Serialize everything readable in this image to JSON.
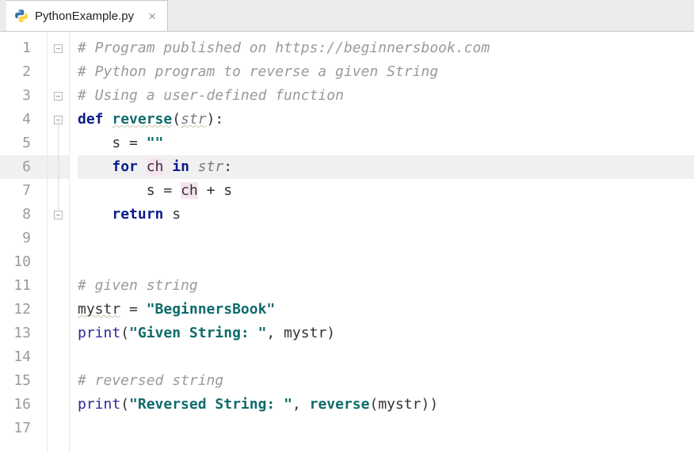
{
  "tab": {
    "filename": "PythonExample.py",
    "icon": "python-file-icon"
  },
  "editor": {
    "highlighted_line": 6,
    "line_numbers": [
      "1",
      "2",
      "3",
      "4",
      "5",
      "6",
      "7",
      "8",
      "9",
      "10",
      "11",
      "12",
      "13",
      "14",
      "15",
      "16",
      "17"
    ],
    "code_lines": [
      {
        "n": 1,
        "tokens": [
          {
            "t": "# Program published on https://beginnersbook.com",
            "c": "c-comment"
          }
        ]
      },
      {
        "n": 2,
        "tokens": [
          {
            "t": "# Python program to reverse a given String",
            "c": "c-comment"
          }
        ]
      },
      {
        "n": 3,
        "tokens": [
          {
            "t": "# Using a user-defined function",
            "c": "c-comment"
          }
        ]
      },
      {
        "n": 4,
        "tokens": [
          {
            "t": "def ",
            "c": "c-keyword"
          },
          {
            "t": "reverse",
            "c": "c-funcname c-squiggle"
          },
          {
            "t": "("
          },
          {
            "t": "str",
            "c": "c-param c-squiggle"
          },
          {
            "t": "):"
          }
        ]
      },
      {
        "n": 5,
        "indent": 1,
        "tokens": [
          {
            "t": "s = "
          },
          {
            "t": "\"\"",
            "c": "c-string"
          }
        ]
      },
      {
        "n": 6,
        "indent": 1,
        "tokens": [
          {
            "t": "for ",
            "c": "c-keyword"
          },
          {
            "t": "ch",
            "c": "c-hilite"
          },
          {
            "t": " in ",
            "c": "c-keyword"
          },
          {
            "t": "str",
            "c": "c-param"
          },
          {
            "t": ":"
          }
        ]
      },
      {
        "n": 7,
        "indent": 2,
        "tokens": [
          {
            "t": "s = "
          },
          {
            "t": "ch",
            "c": "c-hilite"
          },
          {
            "t": " + s"
          }
        ]
      },
      {
        "n": 8,
        "indent": 1,
        "tokens": [
          {
            "t": "return ",
            "c": "c-keyword"
          },
          {
            "t": "s"
          }
        ]
      },
      {
        "n": 9,
        "tokens": []
      },
      {
        "n": 10,
        "tokens": []
      },
      {
        "n": 11,
        "tokens": [
          {
            "t": "# given string",
            "c": "c-comment"
          }
        ]
      },
      {
        "n": 12,
        "tokens": [
          {
            "t": "mystr",
            "c": "c-squiggle"
          },
          {
            "t": " = "
          },
          {
            "t": "\"BeginnersBook\"",
            "c": "c-string"
          }
        ]
      },
      {
        "n": 13,
        "tokens": [
          {
            "t": "print",
            "c": "c-builtin"
          },
          {
            "t": "("
          },
          {
            "t": "\"Given String: \"",
            "c": "c-string"
          },
          {
            "t": ", mystr)"
          }
        ]
      },
      {
        "n": 14,
        "tokens": []
      },
      {
        "n": 15,
        "tokens": [
          {
            "t": "# reversed string",
            "c": "c-comment"
          }
        ]
      },
      {
        "n": 16,
        "tokens": [
          {
            "t": "print",
            "c": "c-builtin"
          },
          {
            "t": "("
          },
          {
            "t": "\"Reversed String: \"",
            "c": "c-string"
          },
          {
            "t": ", "
          },
          {
            "t": "reverse",
            "c": "c-funcname"
          },
          {
            "t": "(mystr))"
          }
        ]
      },
      {
        "n": 17,
        "tokens": []
      }
    ],
    "fold_markers": {
      "1": "open",
      "3": "open",
      "4": "open",
      "8": "close"
    }
  }
}
